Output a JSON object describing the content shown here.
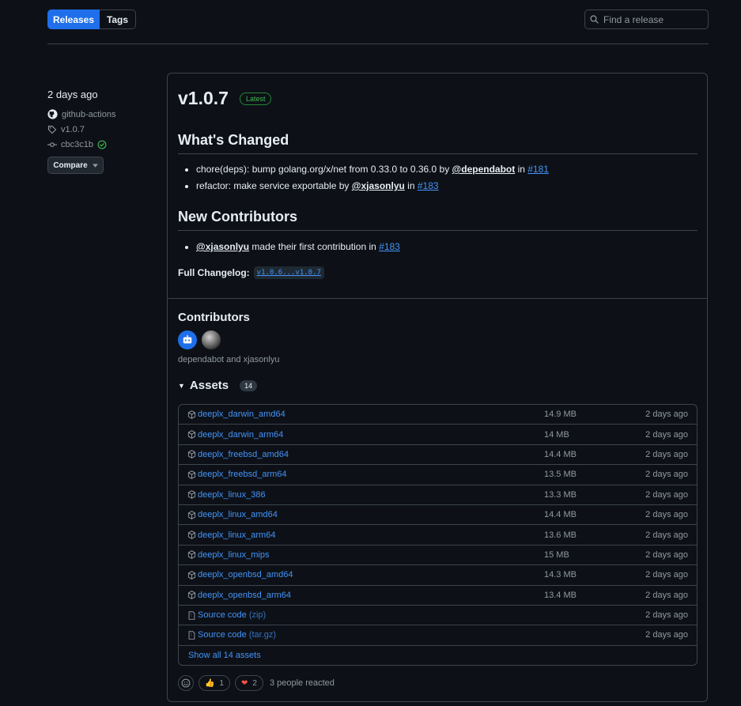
{
  "tabs": {
    "releases": "Releases",
    "tags": "Tags"
  },
  "search": {
    "placeholder": "Find a release"
  },
  "meta": {
    "date": "2 days ago",
    "author": "github-actions",
    "tag": "v1.0.7",
    "commit": "cbc3c1b",
    "compare_label": "Compare"
  },
  "release": {
    "version": "v1.0.7",
    "badge": "Latest",
    "whats_changed_title": "What's Changed",
    "changes": [
      {
        "text": "chore(deps): bump golang.org/x/net from 0.33.0 to 0.36.0 by ",
        "author": "@dependabot",
        "in": " in ",
        "pr": "#181"
      },
      {
        "text": "refactor: make service exportable by ",
        "author": "@xjasonlyu",
        "in": " in ",
        "pr": "#183"
      }
    ],
    "new_contributors_title": "New Contributors",
    "new_contributors": [
      {
        "author": "@xjasonlyu",
        "text": " made their first contribution in ",
        "pr": "#183"
      }
    ],
    "changelog_label": "Full Changelog:",
    "changelog_link": "v1.0.6...v1.0.7"
  },
  "contributors": {
    "title": "Contributors",
    "names": "dependabot and xjasonlyu"
  },
  "assets": {
    "title": "Assets",
    "count": "14",
    "rows": [
      {
        "name": "deeplx_darwin_amd64",
        "size": "14.9 MB",
        "date": "2 days ago"
      },
      {
        "name": "deeplx_darwin_arm64",
        "size": "14 MB",
        "date": "2 days ago"
      },
      {
        "name": "deeplx_freebsd_amd64",
        "size": "14.4 MB",
        "date": "2 days ago"
      },
      {
        "name": "deeplx_freebsd_arm64",
        "size": "13.5 MB",
        "date": "2 days ago"
      },
      {
        "name": "deeplx_linux_386",
        "size": "13.3 MB",
        "date": "2 days ago"
      },
      {
        "name": "deeplx_linux_amd64",
        "size": "14.4 MB",
        "date": "2 days ago"
      },
      {
        "name": "deeplx_linux_arm64",
        "size": "13.6 MB",
        "date": "2 days ago"
      },
      {
        "name": "deeplx_linux_mips",
        "size": "15 MB",
        "date": "2 days ago"
      },
      {
        "name": "deeplx_openbsd_amd64",
        "size": "14.3 MB",
        "date": "2 days ago"
      },
      {
        "name": "deeplx_openbsd_arm64",
        "size": "13.4 MB",
        "date": "2 days ago"
      }
    ],
    "source": [
      {
        "name": "Source code",
        "ext": "(zip)",
        "date": "2 days ago"
      },
      {
        "name": "Source code",
        "ext": "(tar.gz)",
        "date": "2 days ago"
      }
    ],
    "show_all": "Show all 14 assets"
  },
  "reactions": {
    "thumbs_count": "1",
    "heart_count": "2",
    "summary": "3 people reacted"
  },
  "colors": {
    "accent": "#1f6feb",
    "link": "#4493f8",
    "success": "#3fb950",
    "bg": "#0d1117",
    "border": "#3d444d"
  }
}
